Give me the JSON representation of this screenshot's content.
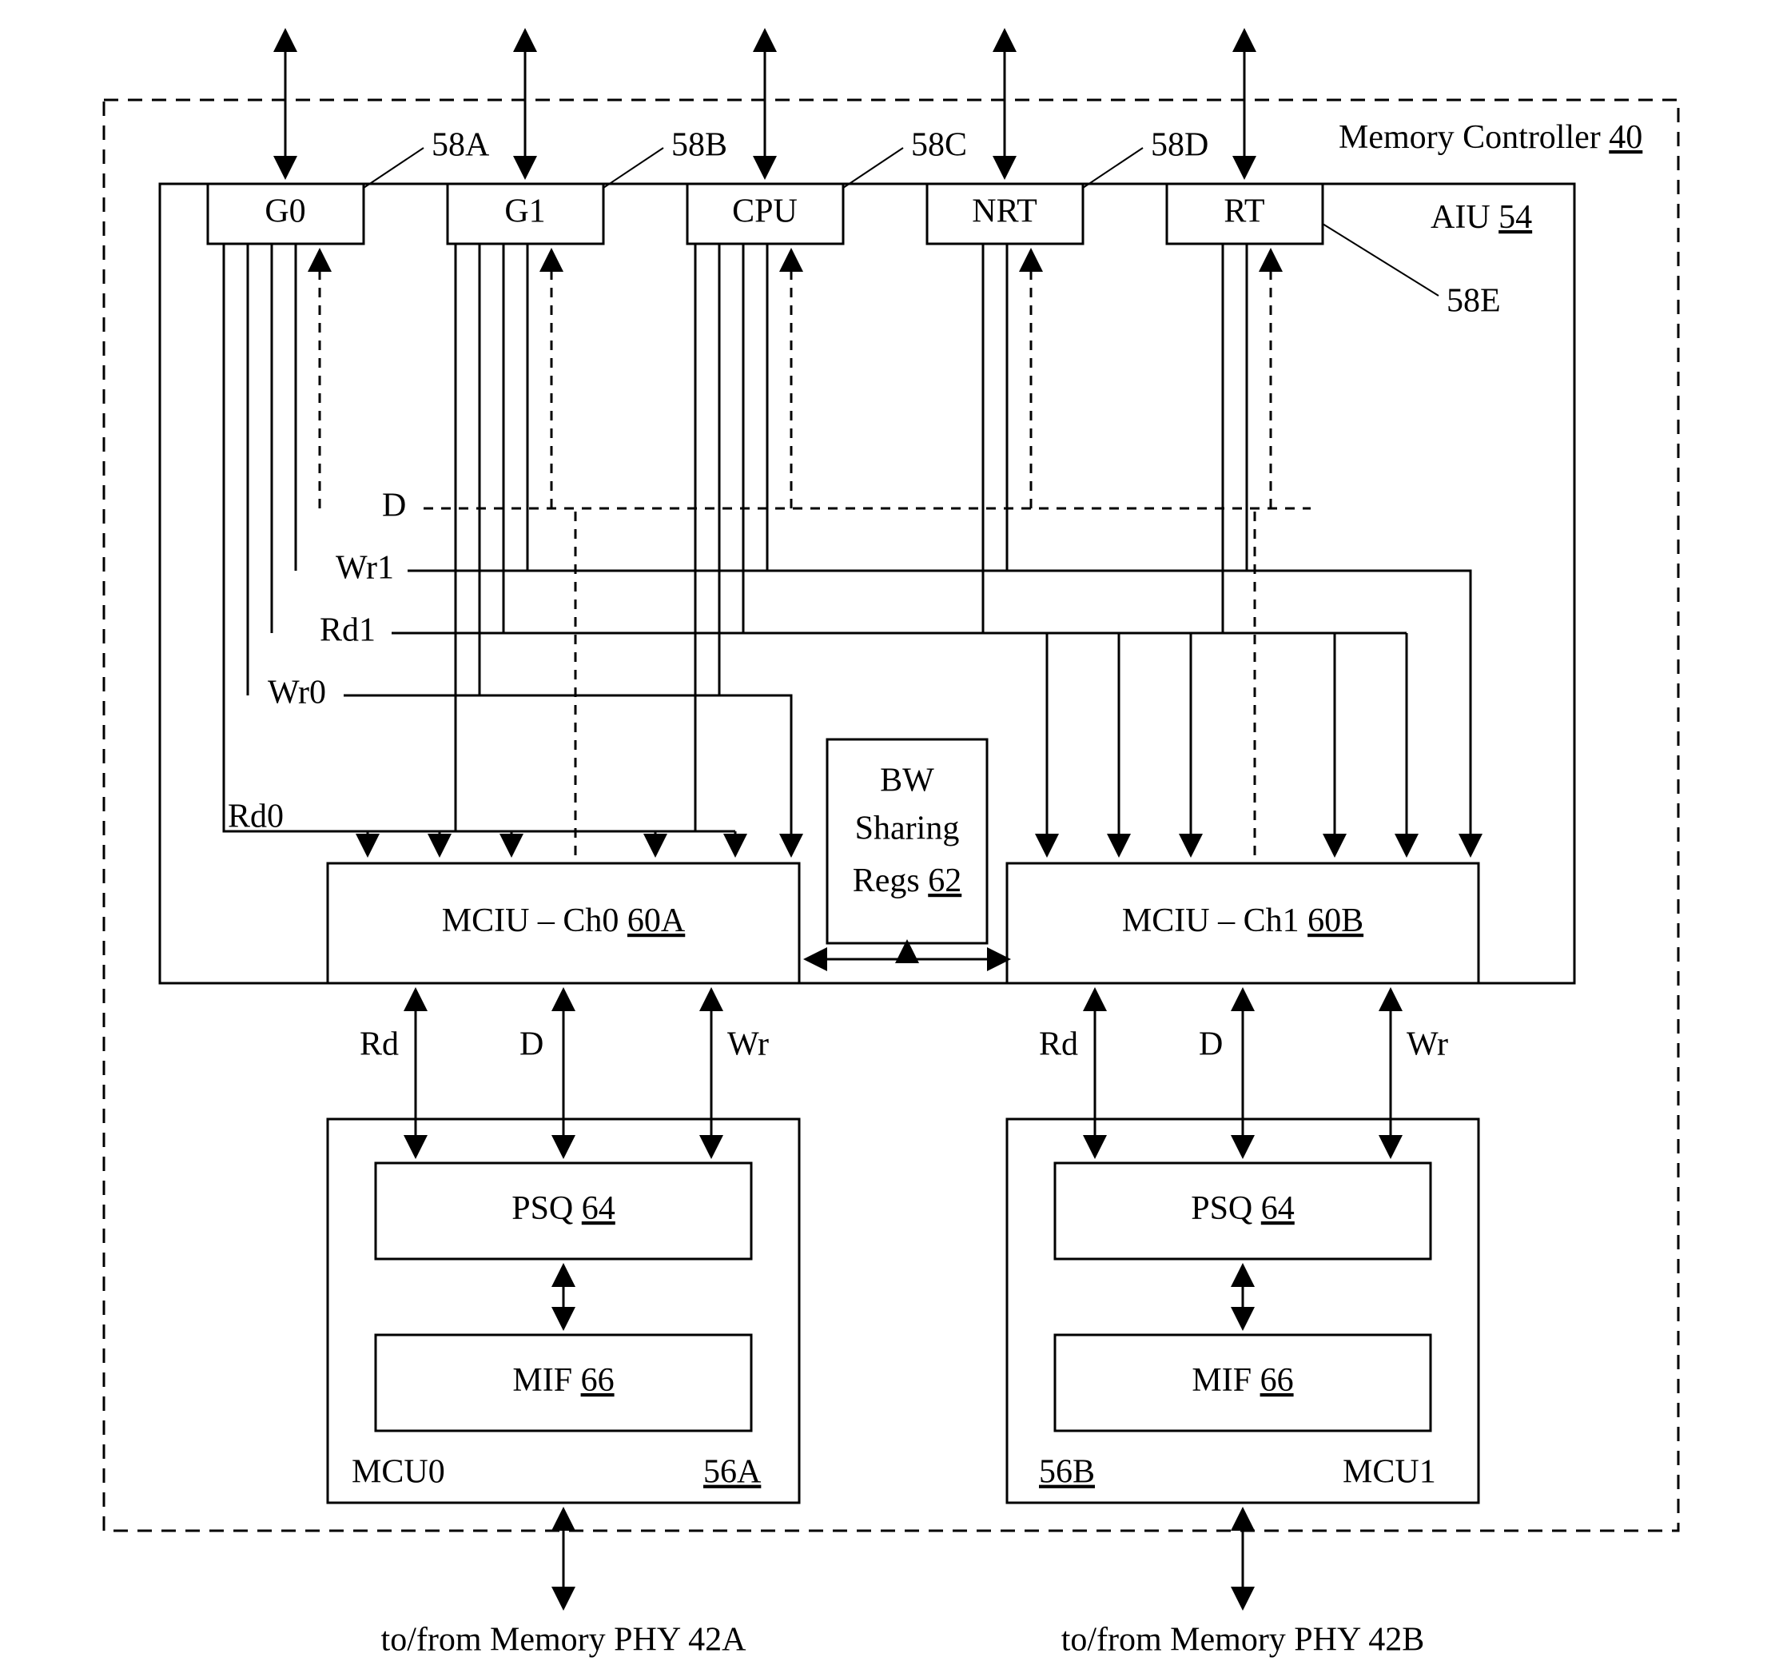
{
  "title": {
    "main": "Memory Controller",
    "ref": "40"
  },
  "aiu": {
    "label": "AIU",
    "ref": "54"
  },
  "ports": [
    {
      "id": "G0",
      "ref": "58A"
    },
    {
      "id": "G1",
      "ref": "58B"
    },
    {
      "id": "CPU",
      "ref": "58C"
    },
    {
      "id": "NRT",
      "ref": "58D"
    },
    {
      "id": "RT",
      "ref": "58E"
    }
  ],
  "buses": {
    "d": "D",
    "wr1": "Wr1",
    "rd1": "Rd1",
    "wr0": "Wr0",
    "rd0": "Rd0"
  },
  "mciu": [
    {
      "label": "MCIU – Ch0",
      "ref": "60A"
    },
    {
      "label": "MCIU – Ch1",
      "ref": "60B"
    }
  ],
  "bw": {
    "l1": "BW",
    "l2": "Sharing",
    "l3": "Regs",
    "ref": "62"
  },
  "mcu_sig": {
    "rd": "Rd",
    "d": "D",
    "wr": "Wr"
  },
  "psq": {
    "label": "PSQ",
    "ref": "64"
  },
  "mif": {
    "label": "MIF",
    "ref": "66"
  },
  "mcu": [
    {
      "label": "MCU0",
      "ref": "56A",
      "phy": "to/from Memory PHY 42A"
    },
    {
      "label": "MCU1",
      "ref": "56B",
      "phy": "to/from Memory PHY 42B"
    }
  ]
}
